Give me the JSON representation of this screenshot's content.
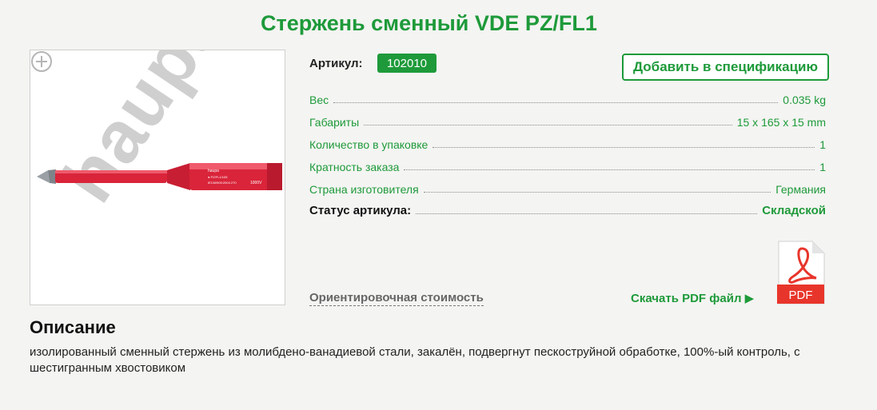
{
  "product": {
    "title": "Стержень сменный VDE PZ/FL1",
    "image_watermark": "haupa",
    "sku_label": "Артикул:",
    "sku_value": "102010",
    "add_to_spec_label": "Добавить в спецификацию"
  },
  "specs": [
    {
      "label": "Вес",
      "value": "0.035 kg"
    },
    {
      "label": "Габариты",
      "value": "15 x 165 x 15 mm"
    },
    {
      "label": "Количество в упаковке",
      "value": "1"
    },
    {
      "label": "Кратность заказа",
      "value": "1"
    },
    {
      "label": "Страна изготовителя",
      "value": "Германия"
    }
  ],
  "status": {
    "label": "Статус артикула:",
    "value": "Складской"
  },
  "actions": {
    "approx_cost_label": "Ориентировочная стоимость",
    "download_pdf_label": "Скачать PDF файл ▶",
    "pdf_icon_text": "PDF"
  },
  "description": {
    "heading": "Описание",
    "text": "изолированный сменный стержень из молибдено-ванадиевой стали, закалён, подвергнут пескоструйной обработке, 100%-ый контроль, с шестигранным хвостовиком"
  },
  "colors": {
    "accent": "#1e9a3a",
    "product_red": "#d9243a",
    "pdf_red": "#e8352b"
  }
}
